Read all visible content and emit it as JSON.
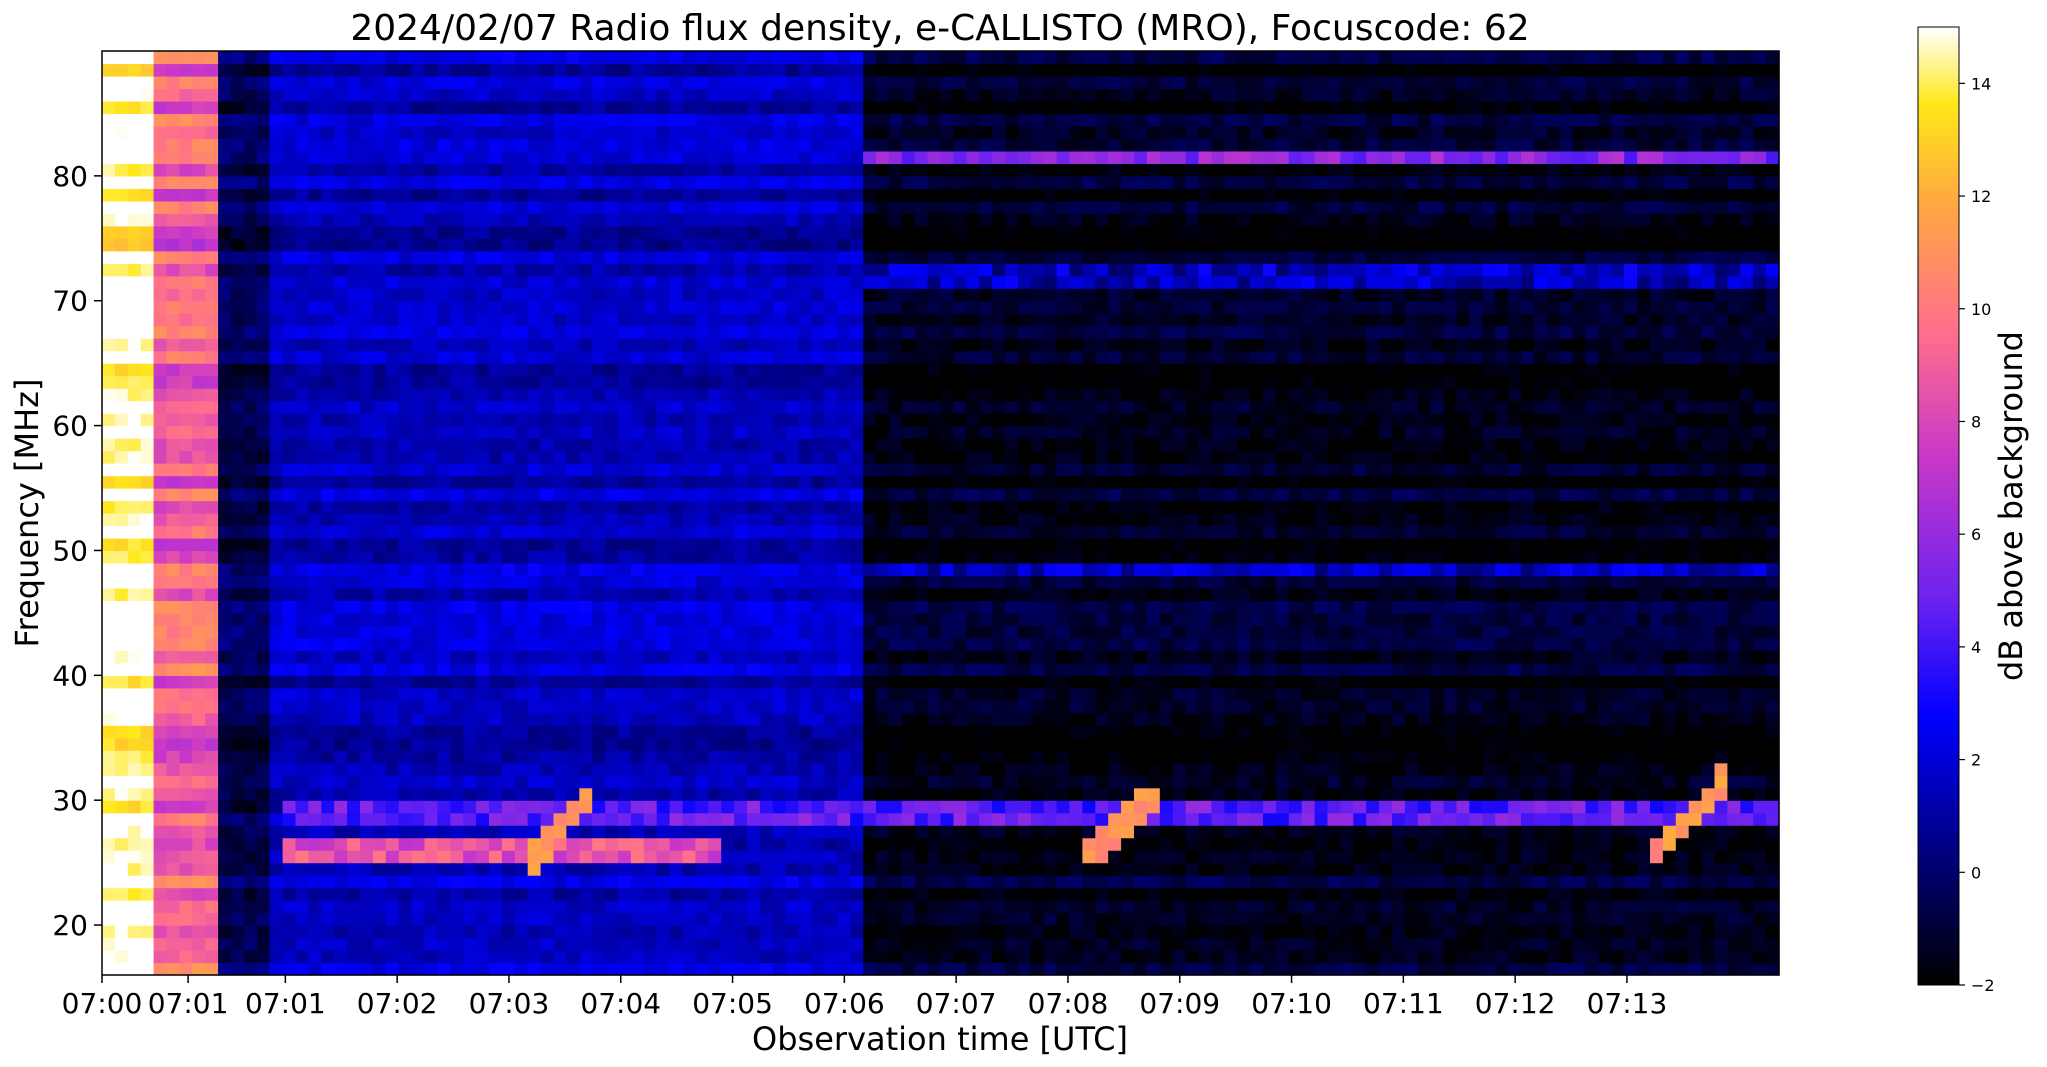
{
  "chart_data": {
    "type": "heatmap",
    "title": "2024/02/07  Radio flux density, e-CALLISTO (MRO), Focuscode: 62",
    "xlabel": "Observation time [UTC]",
    "ylabel": "Frequency [MHz]",
    "x_ticks": [
      "07:00",
      "07:01",
      "07:01",
      "07:02",
      "07:03",
      "07:04",
      "07:05",
      "07:06",
      "07:07",
      "07:08",
      "07:09",
      "07:10",
      "07:11",
      "07:12",
      "07:13"
    ],
    "x_tick_minutes": [
      0,
      0.77,
      1.64,
      2.64,
      3.64,
      4.64,
      5.64,
      6.64,
      7.64,
      8.64,
      9.64,
      10.64,
      11.64,
      12.64,
      13.64
    ],
    "xlim_minutes": [
      0,
      15
    ],
    "y_ticks": [
      20,
      30,
      40,
      50,
      60,
      70,
      80
    ],
    "ylim": [
      16,
      90
    ],
    "colorbar": {
      "label": "dB above background",
      "ticks": [
        -2,
        0,
        2,
        4,
        6,
        8,
        10,
        12,
        14
      ],
      "range": [
        -2,
        15
      ],
      "colormap": "gnuplot2",
      "colors": [
        "#000000",
        "#0000ff",
        "#8a2be2",
        "#ff5f9e",
        "#ffd700",
        "#ffffff"
      ]
    },
    "segments": [
      {
        "t0": 0.0,
        "t1": 0.5,
        "base": 15
      },
      {
        "t0": 0.5,
        "t1": 1.0,
        "base": 9
      },
      {
        "t0": 1.0,
        "t1": 1.5,
        "base": -0.5
      },
      {
        "t0": 1.5,
        "t1": 6.85,
        "base": 1.5
      },
      {
        "t0": 6.85,
        "t1": 15.0,
        "base": -1.5
      }
    ],
    "features": [
      {
        "kind": "band",
        "freq": 29.2,
        "t0": 1.6,
        "t1": 15.0,
        "db": 6
      },
      {
        "kind": "band",
        "freq": 26.0,
        "t0": 1.6,
        "t1": 5.5,
        "db": 10
      },
      {
        "kind": "band",
        "freq": 48.5,
        "t0": 1.6,
        "t1": 15.0,
        "db": 3
      },
      {
        "kind": "band",
        "freq": 81.5,
        "t0": 6.8,
        "t1": 15.0,
        "db": 7
      },
      {
        "kind": "band",
        "freq": 72.0,
        "t0": 6.8,
        "t1": 15.0,
        "db": 3
      },
      {
        "kind": "burst",
        "t0": 3.8,
        "t1": 4.4,
        "f0": 25.0,
        "f1": 30.5,
        "db": 12
      },
      {
        "kind": "burst",
        "t0": 8.8,
        "t1": 9.5,
        "f0": 25.5,
        "f1": 31.0,
        "db": 12
      },
      {
        "kind": "burst",
        "t0": 13.8,
        "t1": 14.5,
        "f0": 25.0,
        "f1": 31.5,
        "db": 12
      }
    ]
  }
}
